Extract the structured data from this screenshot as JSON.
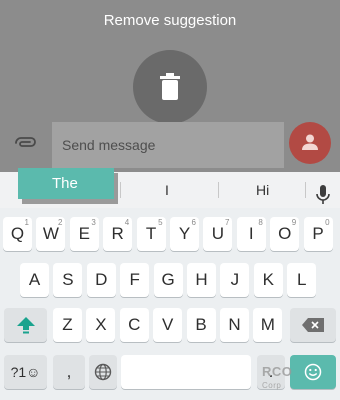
{
  "overlay": {
    "title": "Remove suggestion",
    "trash_icon": "trash-icon"
  },
  "compose": {
    "placeholder": "Send message",
    "attach_icon": "paperclip-icon",
    "contact_icon": "person-icon",
    "contact_color": "#b24a44"
  },
  "suggestions": {
    "dragged": "The",
    "items": [
      "I",
      "Hi"
    ],
    "mic_icon": "microphone-icon",
    "accent": "#5bbaad"
  },
  "keyboard": {
    "row1": [
      "Q",
      "W",
      "E",
      "R",
      "T",
      "Y",
      "U",
      "I",
      "O",
      "P"
    ],
    "row1_hints": [
      "1",
      "2",
      "3",
      "4",
      "5",
      "6",
      "7",
      "8",
      "9",
      "0"
    ],
    "row2": [
      "A",
      "S",
      "D",
      "F",
      "G",
      "H",
      "J",
      "K",
      "L"
    ],
    "row3": [
      "Z",
      "X",
      "C",
      "V",
      "B",
      "N",
      "M"
    ],
    "symbols_label": "?1☺",
    "comma_label": ",",
    "period_label": "."
  },
  "watermark": "RCO",
  "watermark_sub": "Corp"
}
